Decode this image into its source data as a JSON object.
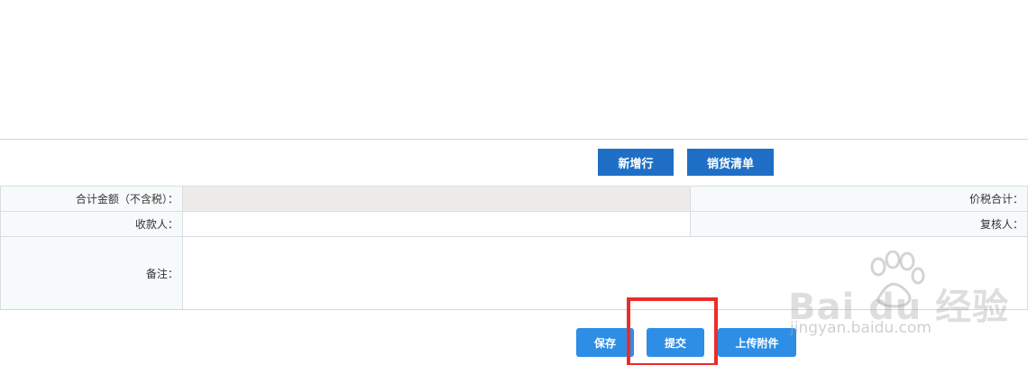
{
  "toolbar": {
    "add_row_label": "新增行",
    "sales_list_label": "销货清单"
  },
  "form": {
    "total_amount_label": "合计金额（不含税）：",
    "total_amount_value": "",
    "price_tax_total_label": "价税合计：",
    "payee_label": "收款人：",
    "payee_value": "",
    "reviewer_label": "复核人：",
    "remarks_label": "备注：",
    "remarks_value": ""
  },
  "actions": {
    "save_label": "保存",
    "submit_label": "提交",
    "upload_label": "上传附件"
  },
  "watermark": {
    "logo_text": "Bai du 经验",
    "url": "jingyan.baidu.com"
  },
  "colors": {
    "dark_button": "#1f6fc6",
    "light_button": "#2e8ee6",
    "highlight": "#ee2b2b"
  }
}
